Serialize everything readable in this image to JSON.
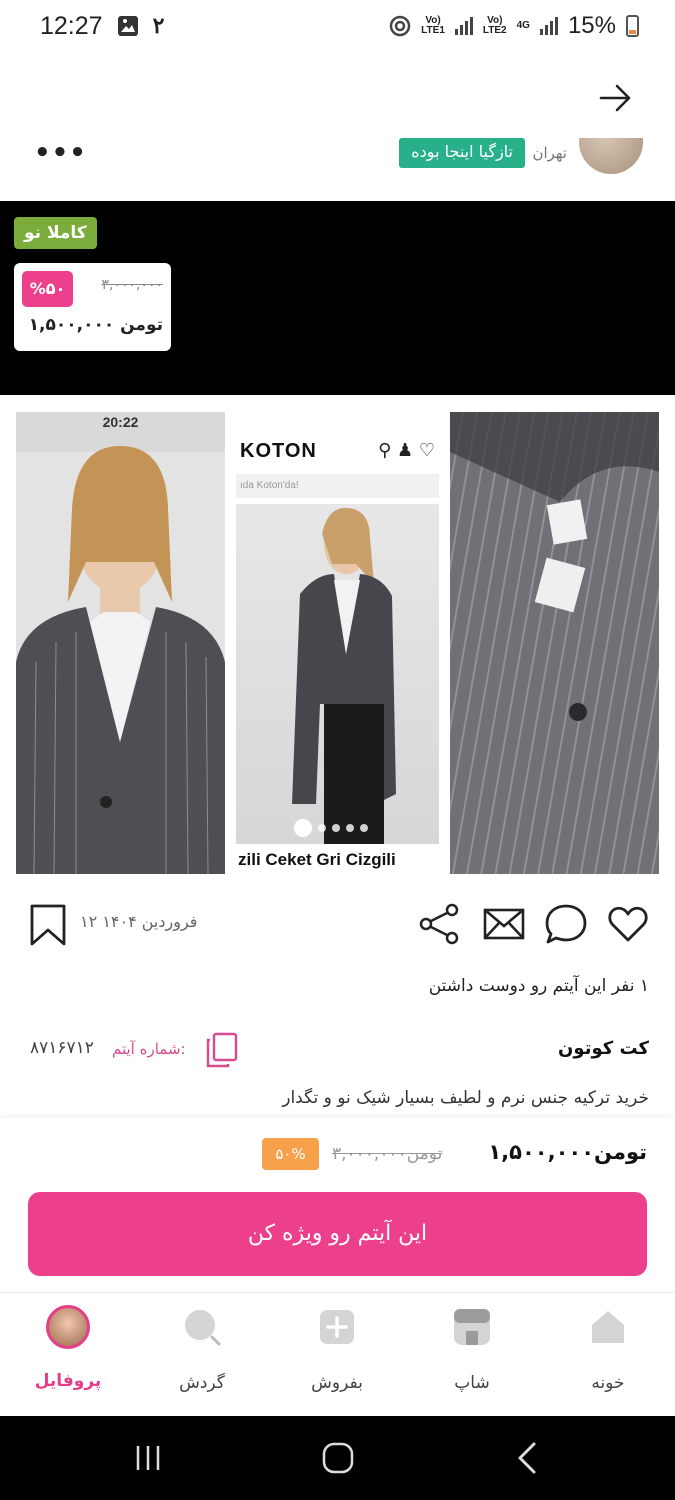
{
  "status_bar": {
    "time": "12:27",
    "notification_count": "۲",
    "sim1": "LTE1",
    "sim2": "LTE2",
    "network": "4G",
    "battery": "15%"
  },
  "seller": {
    "badge": "تازگیا اینجا بوده",
    "city": "تهران"
  },
  "hero": {
    "condition_tag": "کاملا نو",
    "discount": "%۵۰",
    "old_price": "۳,۰۰۰,۰۰۰",
    "new_price": "۱,۵۰۰,۰۰۰ تومن"
  },
  "gallery": {
    "phone_time": "20:22",
    "brand": "KOTON",
    "caption": "zili Ceket Gri Cizgili"
  },
  "actions": {
    "date": "۱۲ فروردین ۱۴۰۴"
  },
  "details": {
    "likes": "۱ نفر این آیتم رو دوست داشتن",
    "title": "کت کوتون",
    "item_number_label": "شماره آیتم:",
    "item_number": "۸۷۱۶۷۱۲",
    "description": "خرید ترکیه جنس نرم و لطیف بسیار شیک نو و تگدار"
  },
  "price_bar": {
    "new_price": "۱,۵۰۰,۰۰۰تومن",
    "old_price": "۳,۰۰۰,۰۰۰تومن",
    "discount": "۵۰%",
    "feature_button": "این آیتم رو ویژه کن"
  },
  "nav": {
    "home": "خونه",
    "shop": "شاپ",
    "sell": "بفروش",
    "explore": "گردش",
    "profile": "پروفایل"
  },
  "colors": {
    "brand_pink": "#ec3f8c",
    "badge_green": "#27b08a",
    "tag_green": "#7cad3c",
    "discount_orange": "#f7a14a"
  }
}
